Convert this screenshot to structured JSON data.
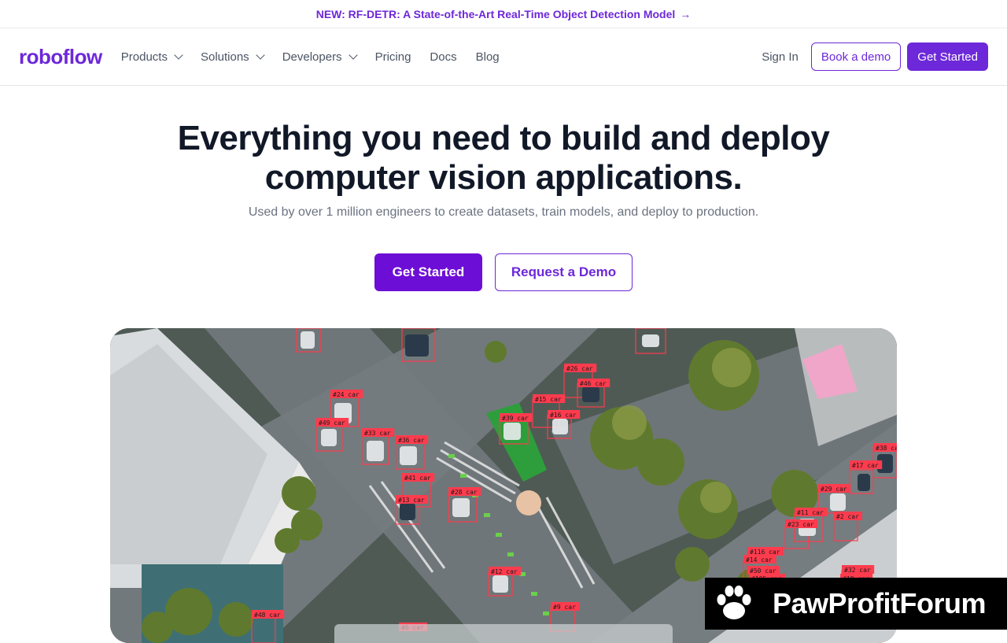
{
  "banner": {
    "text": "NEW: RF-DETR: A State-of-the-Art Real-Time Object Detection Model",
    "arrow": "→"
  },
  "nav": {
    "logo": "roboflow",
    "items": [
      {
        "label": "Products",
        "dropdown": true
      },
      {
        "label": "Solutions",
        "dropdown": true
      },
      {
        "label": "Developers",
        "dropdown": true
      },
      {
        "label": "Pricing",
        "dropdown": false
      },
      {
        "label": "Docs",
        "dropdown": false
      },
      {
        "label": "Blog",
        "dropdown": false
      }
    ],
    "sign_in": "Sign In",
    "book_demo": "Book a demo",
    "get_started": "Get Started"
  },
  "hero": {
    "title_line1": "Everything you need to build and deploy",
    "title_line2": "computer vision applications.",
    "subtitle": "Used by over 1 million engineers to create datasets, train models, and deploy to production.",
    "cta_primary": "Get Started",
    "cta_secondary": "Request a Demo"
  },
  "media": {
    "description_icon": "aerial-intersection-image",
    "detections": [
      "24 car",
      "49 car",
      "33 car",
      "36 car",
      "41 car",
      "13 car",
      "28 car",
      "39 car",
      "15 car",
      "16 car",
      "26 car",
      "46 car",
      "12 car",
      "9 car",
      "48 car",
      "6 car",
      "2 car",
      "17 car",
      "29 car",
      "11 car",
      "23 car",
      "116 car",
      "14 car",
      "50 car",
      "105 car",
      "32 car",
      "18 car",
      "38 car"
    ]
  },
  "watermark": {
    "text": "PawProfitForum",
    "icon": "paw-icon"
  },
  "colors": {
    "brand": "#6d28d9",
    "box": "#ff3b4e"
  }
}
